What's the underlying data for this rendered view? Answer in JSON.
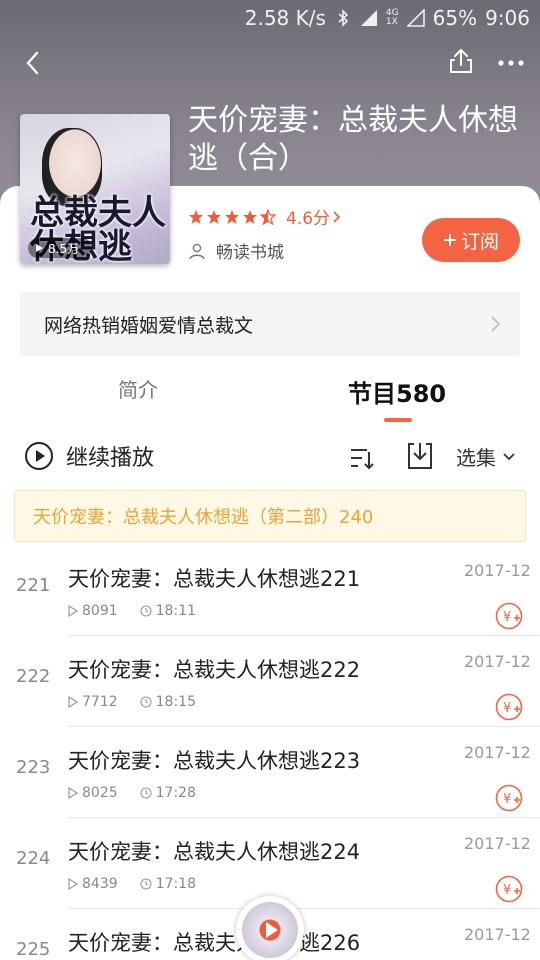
{
  "status": {
    "speed": "2.58 K/s",
    "battery": "65%",
    "time": "9:06",
    "net_top": "4G",
    "net_bottom": "1X"
  },
  "book": {
    "title": "天价宠妻：总裁夫人休想逃（合）",
    "cover_title": "总裁夫人休想逃",
    "cover_play": "8.5万",
    "rating": "4.6分",
    "rating_stars": 4.5,
    "publisher": "畅读书城",
    "subscribe_label": "订阅",
    "tagline": "网络热销婚姻爱情总裁文"
  },
  "tabs": {
    "intro": "简介",
    "episodes": "节目580"
  },
  "controls": {
    "continue_label": "继续播放",
    "select_label": "选集"
  },
  "part_banner": "天价宠妻：总裁夫人休想逃（第二部）240",
  "episodes": [
    {
      "num": "221",
      "title": "天价宠妻：总裁夫人休想逃221",
      "date": "2017-12",
      "plays": "8091",
      "duration": "18:11"
    },
    {
      "num": "222",
      "title": "天价宠妻：总裁夫人休想逃222",
      "date": "2017-12",
      "plays": "7712",
      "duration": "18:15"
    },
    {
      "num": "223",
      "title": "天价宠妻：总裁夫人休想逃223",
      "date": "2017-12",
      "plays": "8025",
      "duration": "17:28"
    },
    {
      "num": "224",
      "title": "天价宠妻：总裁夫人休想逃224",
      "date": "2017-12",
      "plays": "8439",
      "duration": "17:18"
    },
    {
      "num": "225",
      "title": "天价宠妻：总裁夫人休想逃226",
      "date": "2017-12",
      "plays": "",
      "duration": ""
    }
  ],
  "colors": {
    "accent": "#f46443",
    "banner_text": "#e8a43a",
    "banner_bg": "#fff8e5"
  }
}
